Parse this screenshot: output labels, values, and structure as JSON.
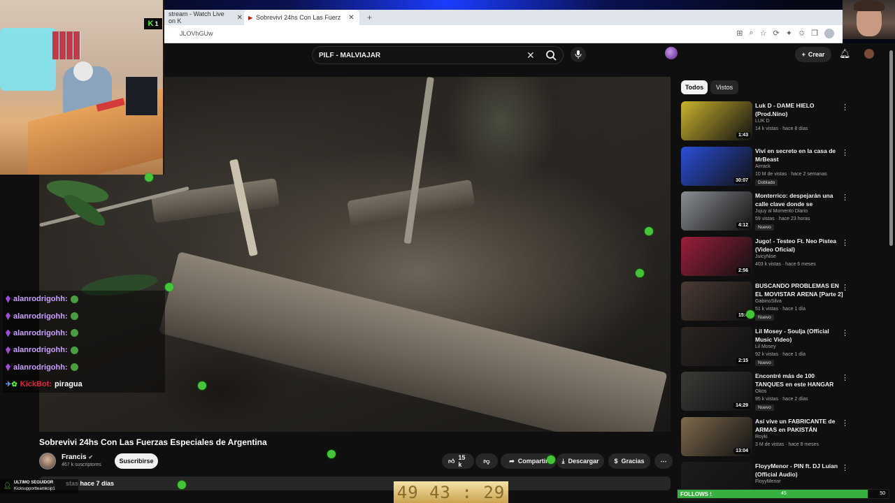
{
  "browser": {
    "tabs": [
      {
        "title": "stream - Watch Live on K"
      },
      {
        "title": "Sobreviví 24hs Con Las Fuerz"
      }
    ],
    "url": "JLOVhGUw"
  },
  "header": {
    "search_value": "PILF - MALVIAJAR",
    "create_label": "Crear"
  },
  "video": {
    "title": "Sobrevivi 24hs Con Las Fuerzas Especiales de Argentina",
    "channel": "Francis",
    "subscribers": "467 k suscriptores",
    "subscribe_label": "Suscribirse",
    "likes": "15 k",
    "share_label": "Compartir",
    "download_label": "Descargar",
    "thanks_label": "Gracias",
    "description_snippet": "stas  hace 7 días"
  },
  "sidebar": {
    "chips": [
      "Todos",
      "Vistos"
    ],
    "items": [
      {
        "title": "Luk D - DAME HIELO (Prod.Nino)",
        "channel": "LUK D",
        "meta": "14 k vistas · hace 8 días",
        "duration": "1:43",
        "tag": "",
        "thumb": "#c9b22e"
      },
      {
        "title": "Viví en secreto en la casa de MrBeast",
        "channel": "Airrack",
        "meta": "10 M de vistas · hace 2 semanas",
        "duration": "30:07",
        "tag": "Doblado",
        "thumb": "#2a4fd8"
      },
      {
        "title": "Monterrico: despejarán una calle clave donde se instalaba...",
        "channel": "Jujuy al Momento Diario",
        "meta": "59 vistas · hace 23 horas",
        "duration": "4:12",
        "tag": "Nuevo",
        "thumb": "#8a8e94"
      },
      {
        "title": "Jugo! - Testeo Ft. Neo Pistea (Video Oficial)",
        "channel": "JuicyNise",
        "meta": "403 k vistas · hace 6 meses",
        "duration": "2:56",
        "tag": "",
        "thumb": "#9b1e3b"
      },
      {
        "title": "BUSCANDO PROBLEMAS EN EL MOVISTAR ARENA [Parte 2]",
        "channel": "GabinoSilva",
        "meta": "51 k vistas · hace 1 día",
        "duration": "15:4",
        "tag": "Nuevo",
        "thumb": "#4a3a34"
      },
      {
        "title": "Lil Mosey - Soulja (Official Music Video)",
        "channel": "Lil Mosey",
        "meta": "92 k vistas · hace 1 día",
        "duration": "2:15",
        "tag": "Nuevo",
        "thumb": "#2b2522"
      },
      {
        "title": "Encontré más de 100 TANQUES en este HANGAR SECRETO",
        "channel": "Okos",
        "meta": "95 k vistas · hace 2 días",
        "duration": "14:29",
        "tag": "Nuevo",
        "thumb": "#3d3b37"
      },
      {
        "title": "Así vive un FABRICANTE de ARMAS en PAKISTÁN",
        "channel": "Royki",
        "meta": "3 M de vistas · hace 8 meses",
        "duration": "13:04",
        "tag": "",
        "thumb": "#7e6a4d"
      },
      {
        "title": "FloyyMenor - PIN ft. DJ Luian (Official Audio)",
        "channel": "FloyyMenor",
        "meta": "",
        "duration": "",
        "tag": "",
        "thumb": "#1c1c1c"
      }
    ]
  },
  "overlay": {
    "kick_count": "1",
    "chat": [
      {
        "user": "alanrodrigohh:",
        "msg": "",
        "bot": false
      },
      {
        "user": "alanrodrigohh:",
        "msg": "",
        "bot": false
      },
      {
        "user": "alanrodrigohh:",
        "msg": "",
        "bot": false
      },
      {
        "user": "alanrodrigohh:",
        "msg": "",
        "bot": false
      },
      {
        "user": "alanrodrigohh:",
        "msg": "",
        "bot": false
      },
      {
        "user": "KickBot:",
        "msg": "piragua",
        "bot": true
      }
    ],
    "follower_label": "ULTIMO SEGUIDOR",
    "follower_name": "Kicksupportteamkcip1",
    "timer": "49 43 : 29",
    "goal_label": "FOLLOWS !",
    "goal_current": "45",
    "goal_target": "50",
    "goal_fraction": 0.9
  },
  "colors": {
    "kick_green": "#53fc18",
    "yt_bg": "#0f0f0f",
    "chat_user": "#c9a0ff",
    "bot_user": "#e4243d"
  }
}
